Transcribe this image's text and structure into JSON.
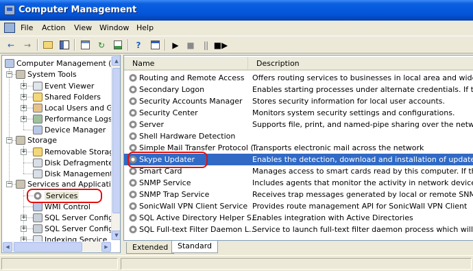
{
  "window": {
    "title": "Computer Management"
  },
  "menu": [
    {
      "label": "File"
    },
    {
      "label": "Action"
    },
    {
      "label": "View"
    },
    {
      "label": "Window"
    },
    {
      "label": "Help"
    }
  ],
  "toolbar": {
    "icons": [
      "back-icon",
      "forward-icon",
      "up-folder-icon",
      "show-hide-tree-icon",
      "properties-icon",
      "refresh-icon",
      "export-list-icon",
      "help-icon",
      "console-icon",
      "start-service-icon",
      "stop-service-icon",
      "pause-service-icon",
      "restart-service-icon"
    ]
  },
  "tree": {
    "root": "Computer Management (Lo",
    "system_tools": "System Tools",
    "event_viewer": "Event Viewer",
    "shared_folders": "Shared Folders",
    "local_users": "Local Users and Gro",
    "performance_logs": "Performance Logs a",
    "device_manager": "Device Manager",
    "storage": "Storage",
    "removable_storage": "Removable Storage",
    "disk_defragmenter": "Disk Defragmenter",
    "disk_management": "Disk Management",
    "services_apps": "Services and Applicatio",
    "services": "Services",
    "wmi_control": "WMI Control",
    "sql_config_1": "SQL Server Configu",
    "sql_config_2": "SQL Server Configu",
    "indexing": "Indexing Service"
  },
  "list": {
    "columns": {
      "name": "Name",
      "description": "Description"
    },
    "rows": [
      {
        "name": "Routing and Remote Access",
        "description": "Offers routing services to businesses in local area and wide area ne"
      },
      {
        "name": "Secondary Logon",
        "description": "Enables starting processes under alternate credentials. If this servi"
      },
      {
        "name": "Security Accounts Manager",
        "description": "Stores security information for local user accounts."
      },
      {
        "name": "Security Center",
        "description": "Monitors system security settings and configurations."
      },
      {
        "name": "Server",
        "description": "Supports file, print, and named-pipe sharing over the network for t"
      },
      {
        "name": "Shell Hardware Detection",
        "description": ""
      },
      {
        "name": "Simple Mail Transfer Protocol (...",
        "description": "Transports electronic mail across the network"
      },
      {
        "name": "Skype Updater",
        "description": "Enables the detection, download and installation of updates for Sky"
      },
      {
        "name": "Smart Card",
        "description": "Manages access to smart cards read by this computer. If this servic"
      },
      {
        "name": "SNMP Service",
        "description": "Includes agents that monitor the activity in network devices and re"
      },
      {
        "name": "SNMP Trap Service",
        "description": "Receives trap messages generated by local or remote SNMP agents"
      },
      {
        "name": "SonicWall VPN Client Service",
        "description": "Provides route management API for SonicWall VPN Client"
      },
      {
        "name": "SQL Active Directory Helper S...",
        "description": "Enables integration with Active Directories"
      },
      {
        "name": "SQL Full-text Filter Daemon L...",
        "description": "Service to launch full-text filter daemon process which will perfo"
      }
    ],
    "selected": "Skype Updater"
  },
  "tabs": [
    {
      "label": "Extended"
    },
    {
      "label": "Standard"
    }
  ],
  "colors": {
    "selection": "#316ac5",
    "annotation": "#e01010",
    "titlebar": "#0454d8"
  }
}
